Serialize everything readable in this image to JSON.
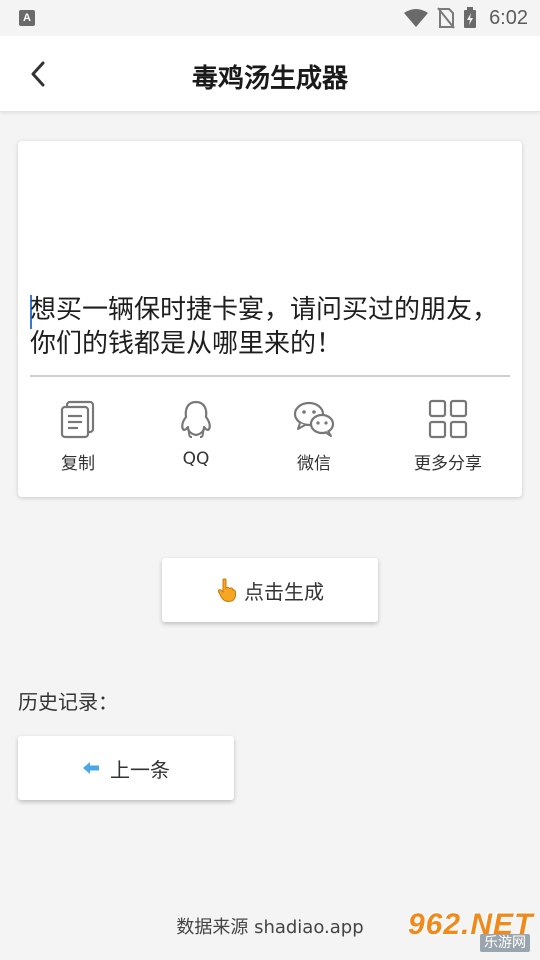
{
  "status_bar": {
    "time": "6:02",
    "left_badge": "A"
  },
  "header": {
    "title": "毒鸡汤生成器"
  },
  "quote": {
    "text": "想买一辆保时捷卡宴，请问买过的朋友，你们的钱都是从哪里来的！"
  },
  "share_actions": [
    {
      "label": "复制",
      "icon": "copy-icon"
    },
    {
      "label": "QQ",
      "icon": "qq-penguin-icon"
    },
    {
      "label": "微信",
      "icon": "wechat-icon"
    },
    {
      "label": "更多分享",
      "icon": "grid-icon"
    }
  ],
  "generate": {
    "label": "点击生成",
    "icon": "pointing-hand-icon"
  },
  "history": {
    "label": "历史记录：",
    "prev_label": "上一条",
    "prev_icon": "arrow-left-icon"
  },
  "footer": {
    "source": "数据来源 shadiao.app"
  },
  "watermark": {
    "main": "962.NET",
    "sub": "乐游网"
  },
  "colors": {
    "accent_orange": "#f5a623",
    "arrow_blue": "#4aa8e8",
    "caret_blue": "#3a78d4"
  }
}
